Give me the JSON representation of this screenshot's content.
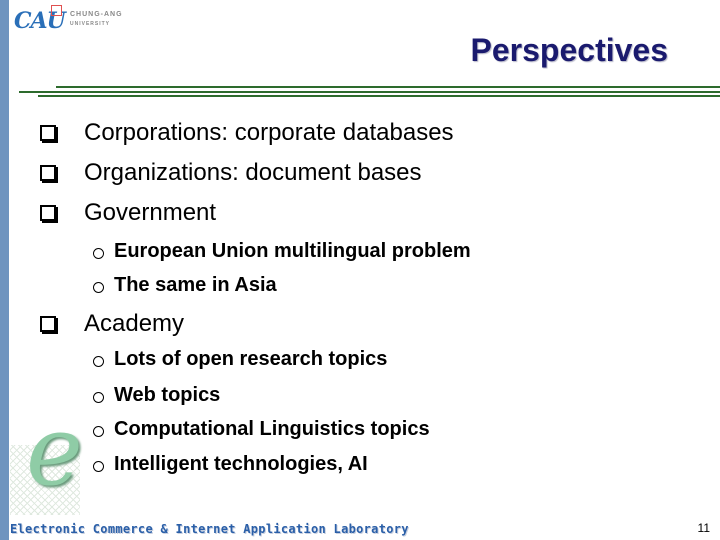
{
  "header": {
    "logo_text": "CAU",
    "university_line1": "CHUNG-ANG",
    "university_line2": "UNIVERSITY",
    "title": "Perspectives"
  },
  "colors": {
    "title": "#1a1a6e",
    "rule": "#2d6b2d",
    "left_bar": "#6f94bf",
    "footer_text": "#2a5fa8"
  },
  "bullets": [
    {
      "text": "Corporations: corporate databases",
      "sub": []
    },
    {
      "text": "Organizations: document bases",
      "sub": []
    },
    {
      "text": "Government",
      "sub": [
        "European Union multilingual problem",
        "The same in Asia"
      ]
    },
    {
      "text": "Academy",
      "sub": [
        "Lots of open research topics",
        "Web topics",
        "Computational Linguistics topics",
        "Intelligent technologies, AI"
      ]
    }
  ],
  "footer": {
    "lab_name": "Electronic Commerce & Internet Application Laboratory",
    "e_logo": "e",
    "page_number": "11"
  }
}
